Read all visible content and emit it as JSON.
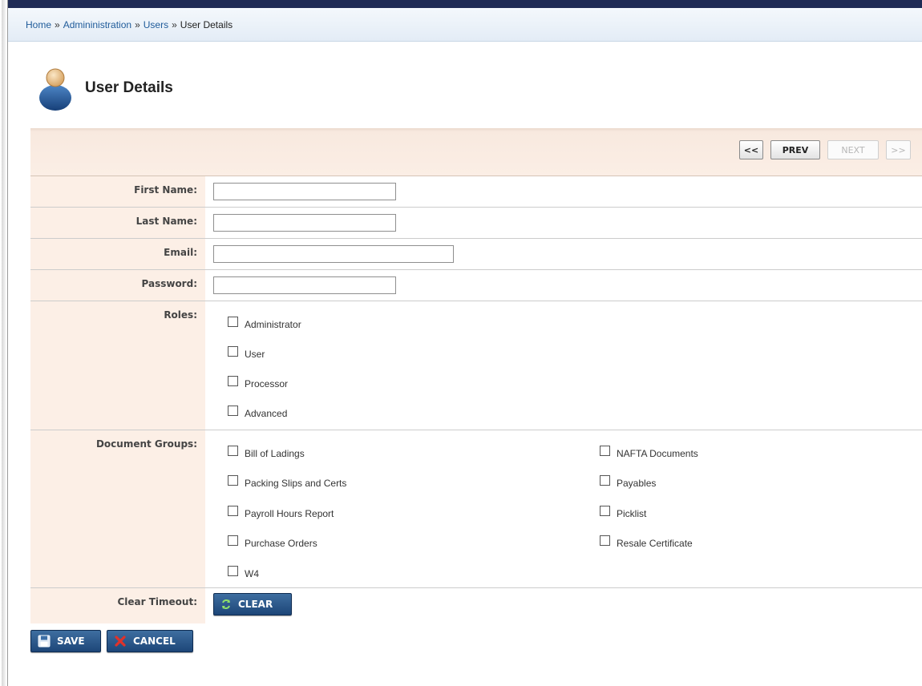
{
  "breadcrumb": {
    "items": [
      "Home",
      "Admininistration",
      "Users"
    ],
    "separator": "»",
    "current": "User Details"
  },
  "page": {
    "title": "User Details",
    "icon": "user-icon"
  },
  "pager": {
    "first": "<<",
    "prev": "PREV",
    "next": "NEXT",
    "last": ">>"
  },
  "fields": {
    "first_name": {
      "label": "First Name:",
      "value": ""
    },
    "last_name": {
      "label": "Last Name:",
      "value": ""
    },
    "email": {
      "label": "Email:",
      "value": ""
    },
    "password": {
      "label": "Password:",
      "value": ""
    }
  },
  "roles": {
    "label": "Roles:",
    "options": [
      "Administrator",
      "User",
      "Processor",
      "Advanced"
    ]
  },
  "document_groups": {
    "label": "Document Groups:",
    "options": [
      "Bill of Ladings",
      "NAFTA Documents",
      "Packing Slips and Certs",
      "Payables",
      "Payroll Hours Report",
      "Picklist",
      "Purchase Orders",
      "Resale Certificate",
      "W4"
    ]
  },
  "clear_timeout": {
    "label": "Clear Timeout:",
    "button": "CLEAR",
    "icon": "refresh-icon"
  },
  "actions": {
    "save": {
      "label": "SAVE",
      "icon": "floppy-disk-icon"
    },
    "cancel": {
      "label": "CANCEL",
      "icon": "red-x-icon"
    }
  },
  "colors": {
    "breadcrumb_link": "#1f5b9a",
    "label_background": "#fcefe6",
    "button_blue": "#1d4678",
    "top_strip": "#1f2b55"
  }
}
